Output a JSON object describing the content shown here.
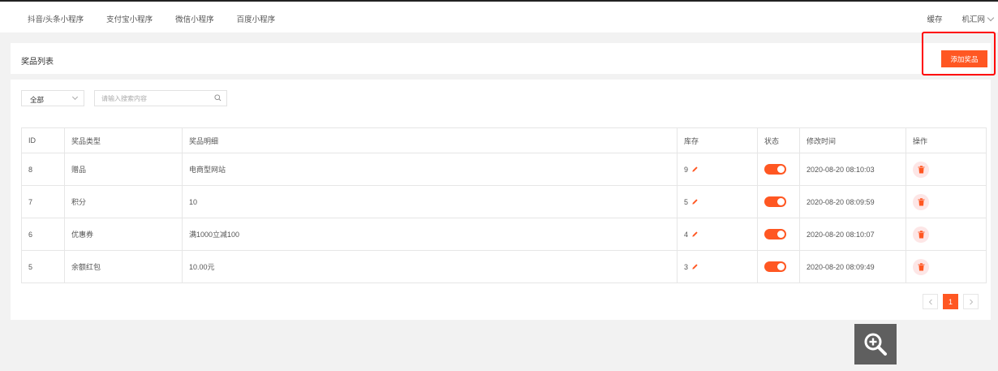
{
  "topnav": {
    "tabs": [
      "抖音/头条小程序",
      "支付宝小程序",
      "微信小程序",
      "百度小程序"
    ],
    "cache_label": "缓存",
    "site_label": "机汇网"
  },
  "header": {
    "title": "奖品列表",
    "add_button_label": "添加奖品"
  },
  "filter": {
    "selected": "全部",
    "search_placeholder": "请输入搜索内容"
  },
  "table": {
    "columns": [
      "ID",
      "奖品类型",
      "奖品明细",
      "库存",
      "状态",
      "修改时间",
      "操作"
    ],
    "rows": [
      {
        "id": "8",
        "type": "赠品",
        "detail": "电商型网站",
        "stock": "9",
        "enabled": true,
        "time": "2020-08-20 08:10:03"
      },
      {
        "id": "7",
        "type": "积分",
        "detail": "10",
        "stock": "5",
        "enabled": true,
        "time": "2020-08-20 08:09:59"
      },
      {
        "id": "6",
        "type": "优惠券",
        "detail": "满1000立减100",
        "stock": "4",
        "enabled": true,
        "time": "2020-08-20 08:10:07"
      },
      {
        "id": "5",
        "type": "余额红包",
        "detail": "10.00元",
        "stock": "3",
        "enabled": true,
        "time": "2020-08-20 08:09:49"
      }
    ]
  },
  "pagination": {
    "current": "1"
  },
  "colors": {
    "accent": "#ff5722",
    "highlight": "#ff0000"
  }
}
